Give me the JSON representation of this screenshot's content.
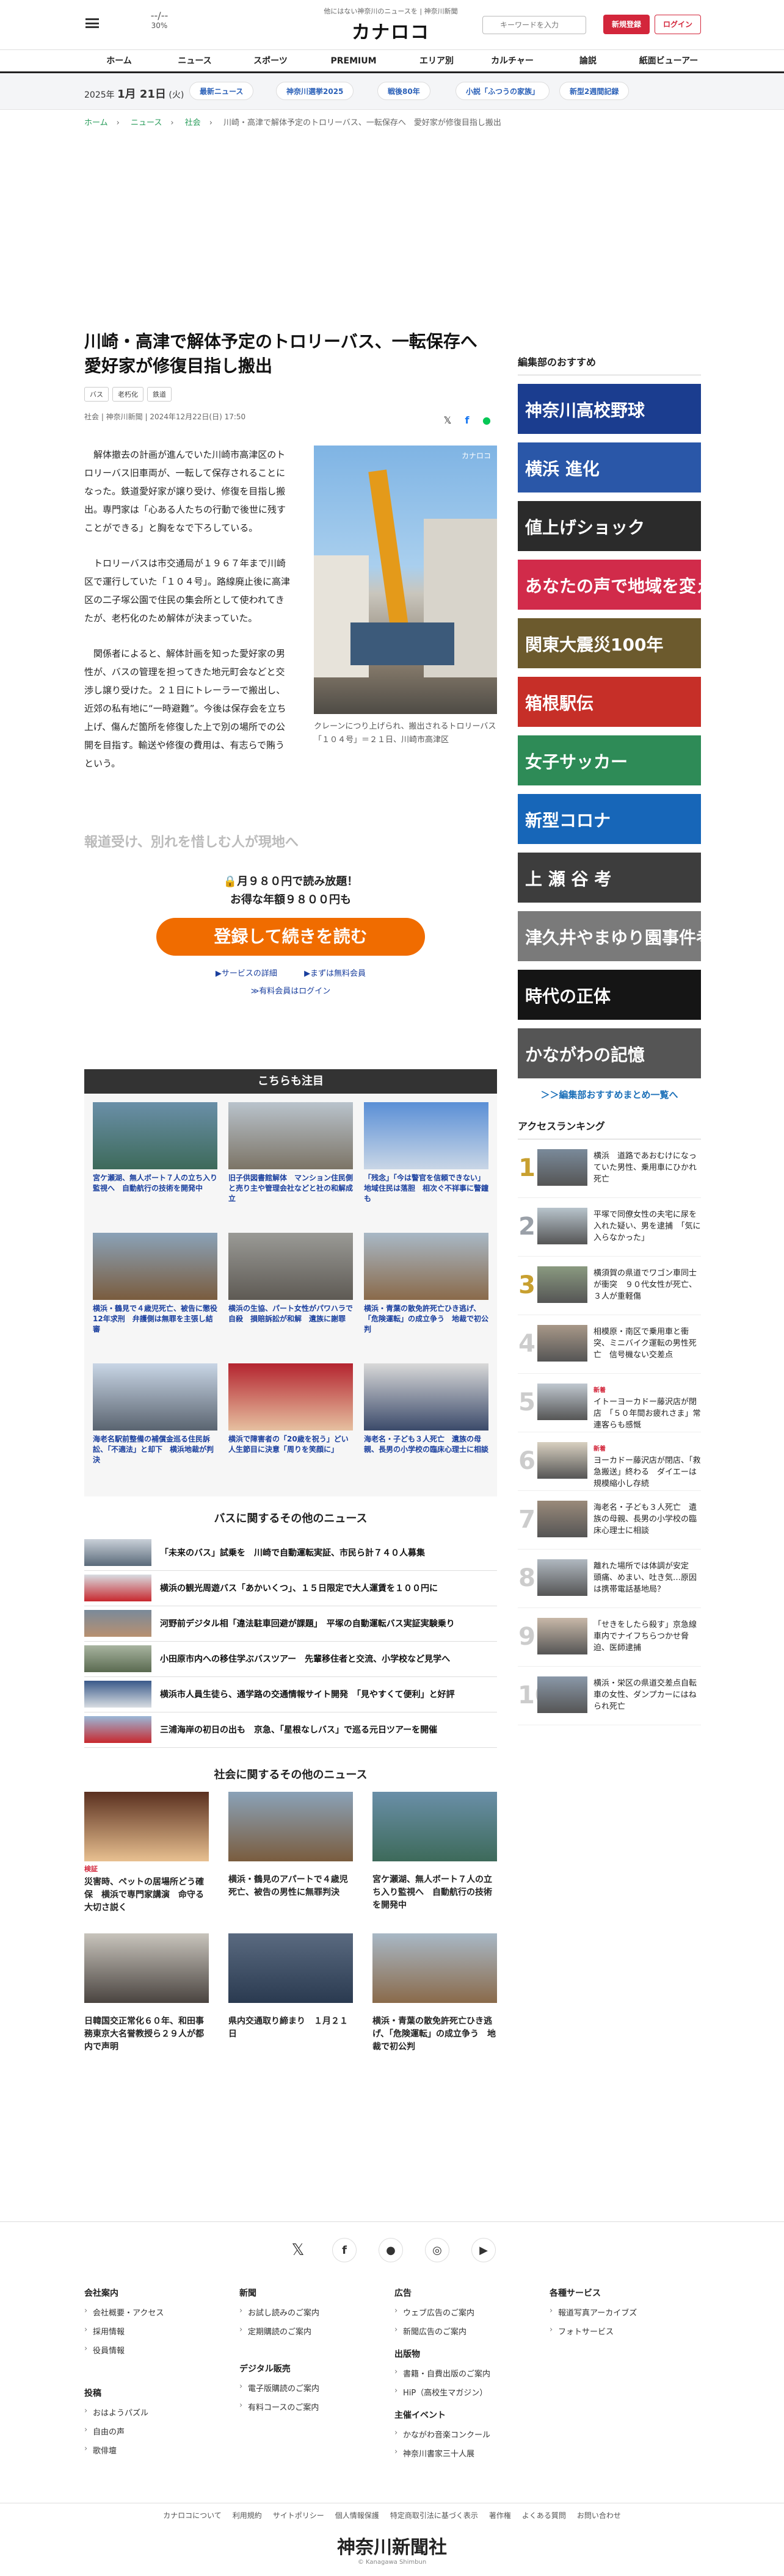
{
  "header": {
    "weather_temp": "--/--",
    "weather_pct": "30%",
    "logo_sub": "他にはない神奈川のニュースを | 神奈川新聞",
    "logo": "カナロコ",
    "search_placeholder": "キーワードを入力",
    "register": "新規登録",
    "login": "ログイン"
  },
  "nav": [
    "ホーム",
    "ニュース",
    "スポーツ",
    "PREMIUM",
    "エリア別",
    "カルチャー",
    "論説",
    "紙面ビューアー"
  ],
  "subbar": {
    "date_year": "2025年",
    "date_md": "1月 21日",
    "date_dow": "(火)",
    "tags": [
      "最新ニュース",
      "神奈川選挙2025",
      "戦後80年",
      "小説「ふつうの家族」",
      "新型2週間記録"
    ]
  },
  "breadcrumb": [
    "ホーム",
    "ニュース",
    "社会",
    "川崎・高津で解体予定のトロリーバス、一転保存へ　愛好家が修復目指し搬出"
  ],
  "article": {
    "title": "川崎・高津で解体予定のトロリーバス、一転保存へ　愛好家が修復目指し搬出",
    "keywords": [
      "バス",
      "老朽化",
      "鉄道"
    ],
    "meta": "社会 | 神奈川新聞 | 2024年12月22日(日) 17:50",
    "paragraphs": [
      "解体撤去の計画が進んでいた川崎市高津区のトロリーバス旧車両が、一転して保存されることになった。鉄道愛好家が譲り受け、修復を目指し搬出。専門家は「心ある人たちの行動で後世に残すことができる」と胸をなで下ろしている。",
      "トロリーバスは市交通局が１９６７年まで川崎区で運行していた「１０４号」。路線廃止後に高津区の二子塚公園で住民の集会所として使われてきたが、老朽化のため解体が決まっていた。",
      "関係者によると、解体計画を知った愛好家の男性が、バスの管理を担ってきた地元町会などと交渉し譲り受けた。２１日にトレーラーで搬出し、近郊の私有地に“一時避難”。今後は保存会を立ち上げ、傷んだ箇所を修復した上で別の場所での公開を目指す。輸送や修復の費用は、有志らで賄うという。"
    ],
    "photo_watermark": "カナロコ",
    "caption": "クレーンにつり上げられ、搬出されるトロリーバス「１０４号」＝２１日、川崎市高津区",
    "fade": "報道受け、別れを惜しむ人が現地へ"
  },
  "paywall": {
    "line1": "月９８０円で読み放題！",
    "line2": "お得な年額９８００円も",
    "cta": "登録して続きを読む",
    "link_service": "▶サービスの詳細",
    "link_free": "▶まずは無料会員",
    "link_login": "≫有料会員はログイン"
  },
  "kochira": {
    "title": "こちらも注目",
    "items": [
      "宮ケ瀬湖、無人ボート７人の立ち入り監視へ　自動航行の技術を開発中",
      "旧子供図書館解体　マンション住民側と売り主や管理会社などと社の和解成立",
      "「残念」「今は警官を信頼できない」地域住民は落胆　相次ぐ不祥事に警鐘も",
      "横浜・鶴見で４歳児死亡、被告に懲役12年求刑　弁護側は無罪を主張し結審",
      "横浜の生協、パート女性がパワハラで自殺　損賠訴訟が和解　遺族に謝罪",
      "横浜・青葉の散免許死亡ひき逃げ、「危険運転」の成立争う　地裁で初公判",
      "海老名駅前整備の補償金巡る住民訴訟、「不適法」と却下　横浜地裁が判決",
      "横浜で障害者の「20歳を祝う」どい　人生節目に決意「周りを笑顔に」",
      "海老名・子ども３人死亡　遺族の母親、長男の小学校の臨床心理士に相談"
    ]
  },
  "bus_news": {
    "title": "バスに関するその他のニュース",
    "items": [
      "「未来のバス」試乗を　川崎で自動運転実証、市民ら計７４０人募集",
      "横浜の観光周遊バス「あかいくつ」、１５日限定で大人運賃を１００円に",
      "河野前デジタル相「違法駐車回避が課題」　平塚の自動運転バス実証実験乗り",
      "小田原市内への移住学ぶバスツアー　先輩移住者と交流、小学校など見学へ",
      "横浜市人員生徒ら、通学路の交通情報サイト開発　「見やすくて便利」と好評",
      "三浦海岸の初日の出も　京急、「星根なしバス」で巡る元日ツアーを開催"
    ]
  },
  "society_news": {
    "title": "社会に関するその他のニュース",
    "items": [
      {
        "badge": "検証",
        "text": "災害時、ペットの居場所どう確保　横浜で専門家講演　命守る大切さ説く"
      },
      {
        "badge": "",
        "text": "横浜・鶴見のアパートで４歳児死亡、被告の男性に無罪判決"
      },
      {
        "badge": "",
        "text": "宮ケ瀬湖、無人ボート７人の立ち入り監視へ　自動航行の技術を開発中"
      },
      {
        "badge": "",
        "text": "日韓国交正常化６０年、和田事務東京大名誉教授ら２９人が都内で声明"
      },
      {
        "badge": "",
        "text": "県内交通取り締まり　１月２１日"
      },
      {
        "badge": "",
        "text": "横浜・青葉の散免許死亡ひき逃げ、「危険運転」の成立争う　地裁で初公判"
      }
    ]
  },
  "sidebar": {
    "title": "編集部のおすすめ",
    "banners": [
      {
        "text": "神奈川高校野球",
        "bg": "#1b3d8f"
      },
      {
        "text": "横浜 進化",
        "bg": "#2a57a8"
      },
      {
        "text": "値上げショック",
        "bg": "#2b2b2b"
      },
      {
        "text": "あなたの声で地域を変えよう",
        "bg": "#d12b4a"
      },
      {
        "text": "関東大震災100年",
        "bg": "#6c5a2d"
      },
      {
        "text": "箱根駅伝",
        "bg": "#c62f28"
      },
      {
        "text": "女子サッカー",
        "bg": "#2e8b57"
      },
      {
        "text": "新型コロナ",
        "bg": "#1766b8"
      },
      {
        "text": "上 瀬 谷 考",
        "bg": "#3d3d3d"
      },
      {
        "text": "津久井やまゆり園事件考",
        "bg": "#7a7a7a"
      },
      {
        "text": "時代の正体",
        "bg": "#151515"
      },
      {
        "text": "かながわの記憶",
        "bg": "#555"
      }
    ],
    "more": "＞＞編集部おすすめまとめ一覧へ",
    "ranking_title": "アクセスランキング",
    "ranking": [
      {
        "new": "",
        "text": "横浜　道路であおむけになっていた男性、乗用車にひかれ死亡"
      },
      {
        "new": "",
        "text": "平塚で同僚女性の夫宅に尿を入れた疑い、男を逮捕　「気に入らなかった」"
      },
      {
        "new": "",
        "text": "横須賀の県道でワゴン車同士が衝突　９０代女性が死亡、３人が重軽傷"
      },
      {
        "new": "",
        "text": "相模原・南区で乗用車と衝突、ミニバイク運転の男性死亡　信号機ない交差点"
      },
      {
        "new": "新着",
        "text": "イトーヨーカドー藤沢店が閉店　「５０年間お疲れさま」常連客らも感慨"
      },
      {
        "new": "新着",
        "text": "ヨーカドー藤沢店が閉店、「救急搬送」終わる　ダイエーは規模縮小し存続"
      },
      {
        "new": "",
        "text": "海老名・子ども３人死亡　遺族の母親、長男の小学校の臨床心理士に相談"
      },
      {
        "new": "",
        "text": "離れた場所では体調が安定　頭痛、めまい、吐き気…原因は携帯電話基地局？"
      },
      {
        "new": "",
        "text": "「せきをしたら殺す」京急線車内でナイフちらつかせ脅迫、医師逮捕"
      },
      {
        "new": "",
        "text": "横浜・栄区の県道交差点自転車の女性、ダンプカーにはねられ死亡"
      }
    ]
  },
  "footer": {
    "cols": [
      {
        "h": "会社案内",
        "i": [
          "会社概要・アクセス",
          "採用情報",
          "役員情報"
        ]
      },
      {
        "h": "新聞",
        "i": [
          "お試し読みのご案内",
          "定期購読のご案内"
        ]
      },
      {
        "h": "デジタル販売",
        "i": [
          "電子版購読のご案内",
          "有料コースのご案内"
        ]
      },
      {
        "h": "広告",
        "i": [
          "ウェブ広告のご案内",
          "新聞広告のご案内"
        ]
      },
      {
        "h": "出版物",
        "i": [
          "書籍・自費出版のご案内",
          "HiP（高校生マガジン）"
        ]
      },
      {
        "h": "主催イベント",
        "i": [
          "かながわ音楽コンクール",
          "神奈川書家三十人展"
        ]
      },
      {
        "h": "各種サービス",
        "i": [
          "報道写真アーカイブズ",
          "フォトサービス"
        ]
      },
      {
        "h": "投稿",
        "i": [
          "おはようパズル",
          "自由の声",
          "歌俳壇"
        ]
      }
    ],
    "bar": [
      "カナロコについて",
      "利用規約",
      "サイトポリシー",
      "個人情報保護",
      "特定商取引法に基づく表示",
      "著作権",
      "よくある質問",
      "お問い合わせ"
    ],
    "logo": "神奈川新聞社",
    "copy": "© Kanagawa Shimbun"
  },
  "colors": {
    "accent": "#d3263b",
    "cta": "#f06c00",
    "link": "#1a3f9e"
  }
}
